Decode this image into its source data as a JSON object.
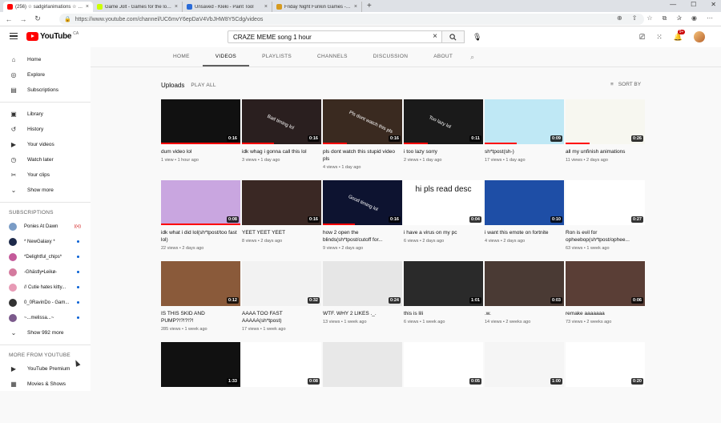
{
  "browser": {
    "tabs": [
      {
        "title": "(256) ☆ sadgirlanimations ☆ - Yo...",
        "color": "#f00"
      },
      {
        "title": "Game Jolt - Games for the love o...",
        "color": "#ccff00"
      },
      {
        "title": "Unsaved - Kleki - Paint Tool",
        "color": "#2a6bd8"
      },
      {
        "title": "Friday Night Funkin Games - Pla...",
        "color": "#d69a1e"
      }
    ],
    "new_tab": "+",
    "url": "https://www.youtube.com/channel/UC6mvY6epDaV4VbJHW8Y5Cdg/videos"
  },
  "youtube": {
    "logo_text": "YouTube",
    "country": "CA",
    "search_value": "CRAZE MEME song 1 hour",
    "notif_count": "9+"
  },
  "sidebar": {
    "main": [
      {
        "label": "Home",
        "icon": "home-icon",
        "glyph": "⌂"
      },
      {
        "label": "Explore",
        "icon": "compass-icon",
        "glyph": "◎"
      },
      {
        "label": "Subscriptions",
        "icon": "subscriptions-icon",
        "glyph": "▤"
      }
    ],
    "library": [
      {
        "label": "Library",
        "icon": "library-icon",
        "glyph": "▣"
      },
      {
        "label": "History",
        "icon": "history-icon",
        "glyph": "↺"
      },
      {
        "label": "Your videos",
        "icon": "your-videos-icon",
        "glyph": "▶"
      },
      {
        "label": "Watch later",
        "icon": "clock-icon",
        "glyph": "◷"
      },
      {
        "label": "Your clips",
        "icon": "scissors-icon",
        "glyph": "✂"
      },
      {
        "label": "Show more",
        "icon": "chevron-down-icon",
        "glyph": "⌄"
      }
    ],
    "subs_heading": "SUBSCRIPTIONS",
    "subscriptions": [
      {
        "name": "Ponies At Dawn",
        "color": "#7a9cc6",
        "status": "live"
      },
      {
        "name": "* NewGalaxy *",
        "color": "#1d2a4a",
        "status": "new"
      },
      {
        "name": "*Delightful_chips*",
        "color": "#c45a9a",
        "status": "new"
      },
      {
        "name": "-Ghästly•Leikø-",
        "color": "#d47a9e",
        "status": "new"
      },
      {
        "name": "// Cutie hates kitty...",
        "color": "#e79ab5",
        "status": "new"
      },
      {
        "name": "0_0RavinDo - Gam...",
        "color": "#333333",
        "status": "new"
      },
      {
        "name": "~...melissa...~",
        "color": "#7b5a8c",
        "status": "new"
      }
    ],
    "subs_more": "Show 992 more",
    "more_heading": "MORE FROM YOUTUBE",
    "more": [
      {
        "label": "YouTube Premium",
        "icon": "youtube-premium-icon",
        "glyph": "▶"
      },
      {
        "label": "Movies & Shows",
        "icon": "film-icon",
        "glyph": "▦"
      }
    ]
  },
  "channel": {
    "tabs": [
      "HOME",
      "VIDEOS",
      "PLAYLISTS",
      "CHANNELS",
      "DISCUSSION",
      "ABOUT"
    ],
    "active_tab": "VIDEOS",
    "section_title": "Uploads",
    "play_all": "PLAY ALL",
    "sort_label": "SORT BY"
  },
  "videos": [
    {
      "title": "dum video lol",
      "views": "1 view",
      "age": "1 hour ago",
      "duration": "0:16",
      "bg": "#111111",
      "progress": 1.0
    },
    {
      "title": "idk whag i gonna call this lol",
      "views": "3 views",
      "age": "1 day ago",
      "duration": "0:16",
      "bg": "#2a1f1f",
      "progress": 0.4
    },
    {
      "title": "pls dont watch this stupid video pls",
      "views": "4 views",
      "age": "1 day ago",
      "duration": "0:16",
      "bg": "#3a2a20",
      "progress": 0.3
    },
    {
      "title": "i too lazy sorry",
      "views": "2 views",
      "age": "1 day ago",
      "duration": "0:11",
      "bg": "#1a1a1a",
      "progress": 0.3
    },
    {
      "title": "sh*tpost(sh-)",
      "views": "17 views",
      "age": "1 day ago",
      "duration": "0:09",
      "bg": "#bfe8f5",
      "progress": 0.4
    },
    {
      "title": "all my unfinish animations",
      "views": "11 views",
      "age": "2 days ago",
      "duration": "0:26",
      "bg": "#f7f7f0",
      "progress": 0.3
    },
    {
      "title": "idk what i did lol(sh*tpost/too fast lol)",
      "views": "22 views",
      "age": "2 days ago",
      "duration": "0:08",
      "bg": "#c9a6e0",
      "progress": 1.0
    },
    {
      "title": "YEET YEET YEET",
      "views": "8 views",
      "age": "2 days ago",
      "duration": "0:16",
      "bg": "#3a2824",
      "progress": 0.0
    },
    {
      "title": "how 2 open the blinds(sh*tpost/cutoff for...",
      "views": "9 views",
      "age": "2 days ago",
      "duration": "0:16",
      "bg": "#0d1330",
      "progress": 0.4
    },
    {
      "title": "i have a virus on my pc",
      "views": "6 views",
      "age": "2 days ago",
      "duration": "0:04",
      "bg": "#ffffff",
      "progress": 0.0
    },
    {
      "title": "i want this emote on fortnite",
      "views": "4 views",
      "age": "2 days ago",
      "duration": "0:10",
      "bg": "#1e4ea6",
      "progress": 0.0
    },
    {
      "title": "Ron is evil for opheebop(sh*tpost/ophee...",
      "views": "63 views",
      "age": "1 week ago",
      "duration": "0:27",
      "bg": "#ffffff",
      "progress": 0.0
    },
    {
      "title": "IS THIS SKID AND PUMP?!?!?!?!",
      "views": "285 views",
      "age": "1 week ago",
      "duration": "0:12",
      "bg": "#8a5a3a",
      "progress": 0.0
    },
    {
      "title": "AAAA TOO FAST AAAAA(sh*tpost)",
      "views": "17 views",
      "age": "1 week ago",
      "duration": "0:32",
      "bg": "#f2f2f2",
      "progress": 0.0
    },
    {
      "title": "WTF. WHY 2 LIKES ._.",
      "views": "13 views",
      "age": "1 week ago",
      "duration": "0:24",
      "bg": "#e6e6e6",
      "progress": 0.0
    },
    {
      "title": "this is lili",
      "views": "6 views",
      "age": "1 week ago",
      "duration": "1:01",
      "bg": "#2a2a2a",
      "progress": 0.0
    },
    {
      "title": ".w.",
      "views": "14 views",
      "age": "2 weeks ago",
      "duration": "0:03",
      "bg": "#4a3a34",
      "progress": 0.0
    },
    {
      "title": "remake aaaaaaa",
      "views": "73 views",
      "age": "2 weeks ago",
      "duration": "0:06",
      "bg": "#5a3e36",
      "progress": 0.0
    },
    {
      "title": "",
      "views": "",
      "age": "",
      "duration": "1:33",
      "bg": "#111111",
      "progress": 0.0
    },
    {
      "title": "",
      "views": "",
      "age": "",
      "duration": "0:08",
      "bg": "#ffffff",
      "progress": 0.0
    },
    {
      "title": "",
      "views": "",
      "age": "",
      "duration": "",
      "bg": "#e8e8e8",
      "progress": 0.0
    },
    {
      "title": "",
      "views": "",
      "age": "",
      "duration": "0:05",
      "bg": "#ffffff",
      "progress": 0.0
    },
    {
      "title": "",
      "views": "",
      "age": "",
      "duration": "1:00",
      "bg": "#f5f5f5",
      "progress": 0.0
    },
    {
      "title": "",
      "views": "",
      "age": "",
      "duration": "0:20",
      "bg": "#ffffff",
      "progress": 0.0
    }
  ],
  "thumb_text": {
    "v2": "Bad timing lol",
    "v3": "Pls dont watch this pls",
    "v4": "Too lazy lol",
    "v9": "Good timing lol",
    "v10": "hi pls read desc"
  }
}
